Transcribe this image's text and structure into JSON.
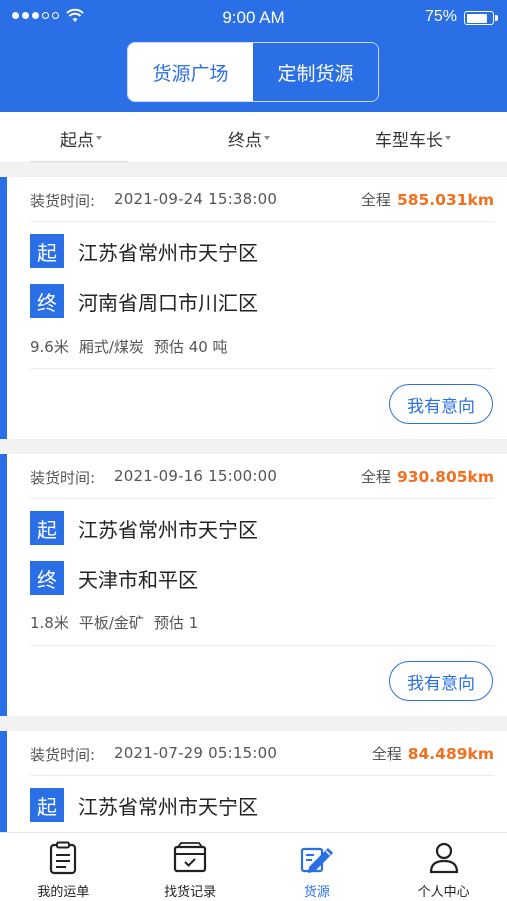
{
  "status_bar": {
    "time": "9:00 AM",
    "battery": "75%"
  },
  "segment": {
    "tab_active": "货源广场",
    "tab_inactive": "定制货源"
  },
  "filters": {
    "origin": "起点",
    "destination": "终点",
    "vehicle": "车型车长"
  },
  "labels": {
    "load_time": "装货时间:",
    "distance": "全程",
    "origin_tag": "起",
    "dest_tag": "终",
    "intent_button": "我有意向"
  },
  "cards": [
    {
      "time": "2021-09-24 15:38:00",
      "distance": "585.031km",
      "origin": "江苏省常州市天宁区",
      "destination": "河南省周口市川汇区",
      "length": "9.6米",
      "type": "厢式/煤炭",
      "estimate": "预估 40 吨"
    },
    {
      "time": "2021-09-16 15:00:00",
      "distance": "930.805km",
      "origin": "江苏省常州市天宁区",
      "destination": "天津市和平区",
      "length": "1.8米",
      "type": "平板/金矿",
      "estimate": "预估 1"
    },
    {
      "time": "2021-07-29 05:15:00",
      "distance": "84.489km",
      "origin": "江苏省常州市天宁区"
    }
  ],
  "tabbar": [
    {
      "label": "我的运单",
      "icon": "clipboard-icon"
    },
    {
      "label": "找货记录",
      "icon": "cargo-record-icon"
    },
    {
      "label": "货源",
      "icon": "cargo-source-icon"
    },
    {
      "label": "个人中心",
      "icon": "person-icon"
    }
  ],
  "colors": {
    "primary": "#2b6fe6",
    "distance": "#f07020"
  }
}
